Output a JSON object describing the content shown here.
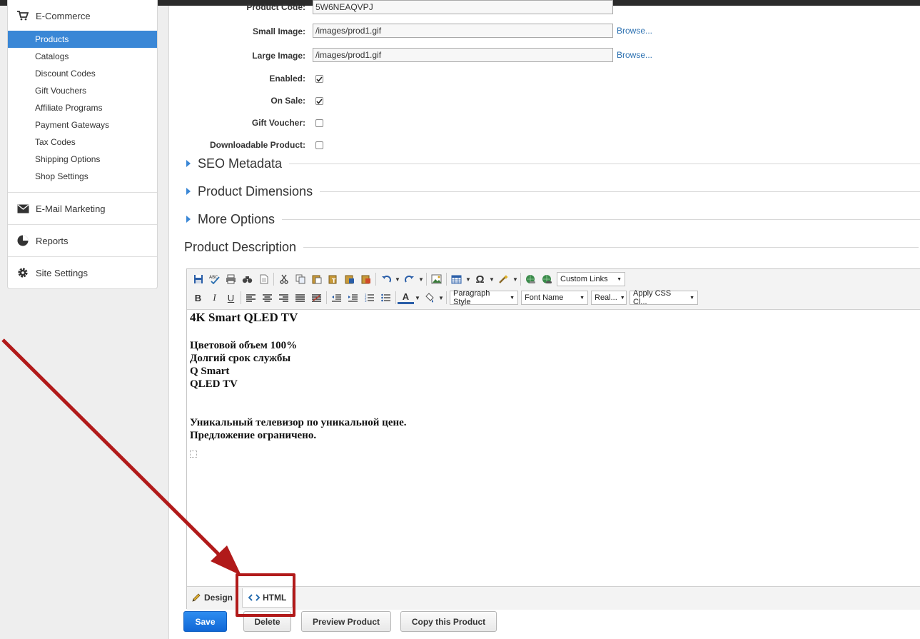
{
  "sidebar": {
    "ecommerce": "E-Commerce",
    "items": [
      "Products",
      "Catalogs",
      "Discount Codes",
      "Gift Vouchers",
      "Affiliate Programs",
      "Payment Gateways",
      "Tax Codes",
      "Shipping Options",
      "Shop Settings"
    ],
    "active_item": "Products",
    "email_marketing": "E-Mail Marketing",
    "reports": "Reports",
    "site_settings": "Site Settings"
  },
  "form": {
    "product_code_label": "Product Code:",
    "product_code_value": "5W6NEAQVPJ",
    "small_image_label": "Small Image:",
    "small_image_value": "/images/prod1.gif",
    "large_image_label": "Large Image:",
    "large_image_value": "/images/prod1.gif",
    "browse": "Browse...",
    "enabled_label": "Enabled:",
    "enabled": true,
    "on_sale_label": "On Sale:",
    "on_sale": true,
    "gift_voucher_label": "Gift Voucher:",
    "gift_voucher": false,
    "downloadable_label": "Downloadable Product:",
    "downloadable": false
  },
  "sections": {
    "seo": "SEO Metadata",
    "dimensions": "Product Dimensions",
    "more_options": "More Options",
    "description": "Product Description"
  },
  "editor": {
    "custom_links": "Custom Links",
    "paragraph_style": "Paragraph Style",
    "font_name": "Font Name",
    "font_size": "Real...",
    "apply_css": "Apply CSS Cl...",
    "content": {
      "heading": "4K Smart QLED TV",
      "line1": "Цветовой объем 100%",
      "line2": "Долгий срок службы",
      "line3": "Q Smart",
      "line4": "QLED TV",
      "line5": "Уникальный телевизор по уникальной цене.",
      "line6": "Предложение ограничено."
    },
    "tab_design": "Design",
    "tab_html": "HTML"
  },
  "buttons": {
    "save": "Save",
    "delete": "Delete",
    "preview": "Preview Product",
    "copy": "Copy this Product"
  },
  "colors": {
    "accent": "#3a87d6",
    "annotation": "#b11a1a",
    "save": "#1a78e6"
  }
}
